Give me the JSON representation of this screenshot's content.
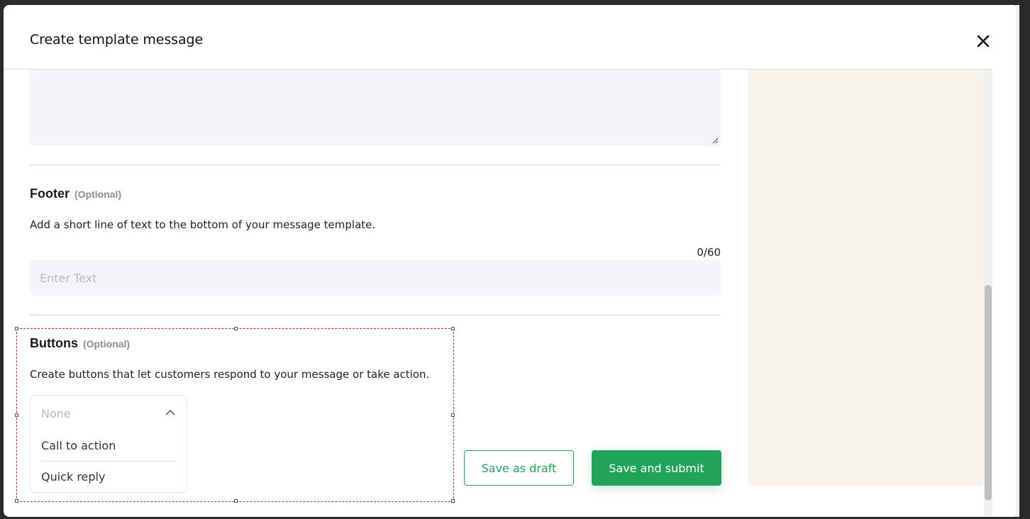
{
  "modal": {
    "title": "Create template message",
    "close_icon": "close-icon"
  },
  "footer_section": {
    "title": "Footer",
    "optional_label": "(Optional)",
    "description": "Add a short line of text to the bottom of your message template.",
    "counter": "0/60",
    "input_placeholder": "Enter Text",
    "input_value": ""
  },
  "buttons_section": {
    "title": "Buttons",
    "optional_label": "(Optional)",
    "description": "Create buttons that let customers respond to your message or take action.",
    "dropdown": {
      "selected": "None",
      "options": [
        "Call to action",
        "Quick reply"
      ]
    }
  },
  "actions": {
    "save_draft_label": "Save as draft",
    "save_submit_label": "Save and submit"
  },
  "colors": {
    "accent": "#22a35a",
    "input_bg": "#f4f5f8",
    "preview_bg": "#f7f3ec"
  }
}
